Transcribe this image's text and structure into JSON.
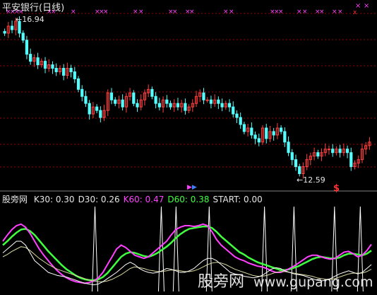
{
  "header": {
    "title": "平安银行(日线)",
    "high_label": "16.94",
    "low_label": "12.59",
    "signal_mark": "$"
  },
  "indicator": {
    "name": "股旁网",
    "items": [
      {
        "label": "K30:",
        "value": "0.30",
        "color": "#e6e6e6"
      },
      {
        "label": "D30:",
        "value": "0.26",
        "color": "#e6e6e6"
      },
      {
        "label": "K60:",
        "value": "0.47",
        "color": "#ff40ff"
      },
      {
        "label": "D60:",
        "value": "0.38",
        "color": "#40ff40"
      },
      {
        "label": "START:",
        "value": "0.00",
        "color": "#e6e6e6"
      }
    ]
  },
  "watermark": {
    "text": "股旁网",
    "url": "www.gupang.com"
  },
  "colors": {
    "background": "#000000",
    "up_candle": "#ff4040",
    "down_candle": "#54ffff",
    "grid": "#a00000",
    "k30_line": "#ffffff",
    "d30_line": "#d8d8a0",
    "k60_line": "#ff40ff",
    "d60_line": "#40ff40",
    "start_line": "#ffffff",
    "marker_magenta": "#ff40ff",
    "marker_red": "#ff3030"
  },
  "chart_data": {
    "type": "candlestick",
    "price_high": 16.94,
    "price_low": 12.59,
    "closes": [
      16.6,
      16.8,
      16.7,
      16.94,
      16.6,
      16.4,
      16.0,
      15.8,
      15.9,
      15.7,
      15.8,
      15.6,
      15.7,
      15.6,
      15.5,
      15.6,
      15.4,
      15.6,
      15.5,
      15.3,
      15.0,
      14.8,
      14.6,
      14.3,
      14.5,
      14.4,
      14.2,
      14.4,
      14.9,
      14.7,
      14.6,
      14.7,
      14.5,
      14.8,
      14.9,
      14.6,
      14.5,
      14.7,
      14.9,
      15.0,
      14.8,
      14.6,
      14.5,
      14.7,
      14.6,
      14.5,
      14.6,
      14.5,
      14.6,
      14.4,
      14.5,
      14.6,
      14.8,
      14.9,
      14.7,
      14.7,
      14.6,
      14.7,
      14.6,
      14.5,
      14.6,
      14.5,
      14.3,
      14.2,
      14.0,
      13.8,
      13.9,
      13.7,
      13.6,
      13.5,
      13.9,
      13.6,
      13.8,
      13.7,
      13.9,
      13.8,
      13.5,
      13.2,
      13.0,
      12.8,
      12.6,
      12.8,
      13.0,
      13.1,
      13.2,
      13.1,
      13.2,
      13.3,
      13.3,
      13.2,
      13.3,
      13.2,
      13.3,
      13.2,
      12.8,
      12.9,
      13.0,
      13.3,
      13.4,
      13.5
    ],
    "k30": [
      0.45,
      0.5,
      0.55,
      0.6,
      0.6,
      0.55,
      0.45,
      0.35,
      0.3,
      0.25,
      0.2,
      0.18,
      0.16,
      0.15,
      0.14,
      0.12,
      0.1,
      0.08,
      0.06,
      0.05,
      0.04,
      0.05,
      0.08,
      0.12,
      0.16,
      0.2,
      0.25,
      0.3,
      0.33,
      0.3,
      0.25,
      0.22,
      0.2,
      0.19,
      0.2,
      0.22,
      0.25,
      0.24,
      0.22,
      0.2,
      0.2,
      0.22,
      0.25,
      0.3,
      0.35,
      0.38,
      0.38,
      0.35,
      0.3,
      0.25,
      0.2,
      0.18,
      0.17,
      0.15,
      0.14,
      0.13,
      0.14,
      0.16,
      0.2,
      0.24,
      0.26,
      0.25,
      0.22,
      0.2,
      0.18,
      0.17,
      0.16,
      0.14,
      0.12,
      0.1,
      0.09,
      0.1,
      0.12,
      0.15,
      0.18,
      0.2,
      0.22,
      0.2,
      0.18,
      0.2,
      0.25,
      0.3
    ],
    "d30": [
      0.4,
      0.43,
      0.47,
      0.5,
      0.53,
      0.52,
      0.48,
      0.43,
      0.38,
      0.34,
      0.3,
      0.27,
      0.24,
      0.22,
      0.2,
      0.18,
      0.16,
      0.14,
      0.12,
      0.1,
      0.09,
      0.08,
      0.08,
      0.09,
      0.11,
      0.14,
      0.17,
      0.21,
      0.25,
      0.27,
      0.26,
      0.25,
      0.23,
      0.22,
      0.21,
      0.21,
      0.22,
      0.23,
      0.23,
      0.22,
      0.21,
      0.21,
      0.22,
      0.24,
      0.27,
      0.3,
      0.32,
      0.33,
      0.32,
      0.3,
      0.27,
      0.24,
      0.22,
      0.2,
      0.18,
      0.16,
      0.15,
      0.15,
      0.16,
      0.18,
      0.2,
      0.21,
      0.21,
      0.2,
      0.19,
      0.18,
      0.17,
      0.16,
      0.15,
      0.13,
      0.12,
      0.11,
      0.11,
      0.12,
      0.14,
      0.16,
      0.18,
      0.19,
      0.19,
      0.19,
      0.21,
      0.24
    ],
    "k60": [
      0.6,
      0.68,
      0.75,
      0.8,
      0.82,
      0.78,
      0.7,
      0.6,
      0.5,
      0.42,
      0.35,
      0.28,
      0.22,
      0.17,
      0.13,
      0.1,
      0.08,
      0.07,
      0.06,
      0.07,
      0.09,
      0.13,
      0.2,
      0.3,
      0.4,
      0.5,
      0.55,
      0.52,
      0.47,
      0.42,
      0.4,
      0.38,
      0.4,
      0.45,
      0.5,
      0.55,
      0.6,
      0.68,
      0.75,
      0.78,
      0.8,
      0.8,
      0.79,
      0.8,
      0.82,
      0.8,
      0.72,
      0.62,
      0.55,
      0.5,
      0.45,
      0.4,
      0.37,
      0.35,
      0.32,
      0.3,
      0.28,
      0.27,
      0.25,
      0.22,
      0.2,
      0.2,
      0.22,
      0.25,
      0.28,
      0.32,
      0.36,
      0.4,
      0.42,
      0.42,
      0.4,
      0.38,
      0.37,
      0.38,
      0.42,
      0.46,
      0.47,
      0.44,
      0.4,
      0.42,
      0.48,
      0.56
    ],
    "d60": [
      0.55,
      0.6,
      0.66,
      0.71,
      0.75,
      0.76,
      0.73,
      0.68,
      0.61,
      0.54,
      0.47,
      0.41,
      0.35,
      0.29,
      0.24,
      0.2,
      0.16,
      0.13,
      0.11,
      0.1,
      0.1,
      0.11,
      0.14,
      0.19,
      0.26,
      0.33,
      0.4,
      0.44,
      0.46,
      0.45,
      0.43,
      0.41,
      0.4,
      0.42,
      0.45,
      0.49,
      0.53,
      0.58,
      0.64,
      0.69,
      0.73,
      0.76,
      0.77,
      0.78,
      0.79,
      0.79,
      0.77,
      0.72,
      0.66,
      0.61,
      0.56,
      0.51,
      0.46,
      0.43,
      0.39,
      0.36,
      0.33,
      0.31,
      0.29,
      0.27,
      0.25,
      0.23,
      0.23,
      0.24,
      0.26,
      0.28,
      0.31,
      0.34,
      0.37,
      0.39,
      0.4,
      0.39,
      0.38,
      0.38,
      0.39,
      0.42,
      0.44,
      0.44,
      0.43,
      0.42,
      0.44,
      0.48
    ],
    "start_spike_index_fraction": [
      0.25,
      0.43,
      0.47,
      0.56,
      0.71,
      0.79,
      0.9,
      0.97
    ]
  }
}
